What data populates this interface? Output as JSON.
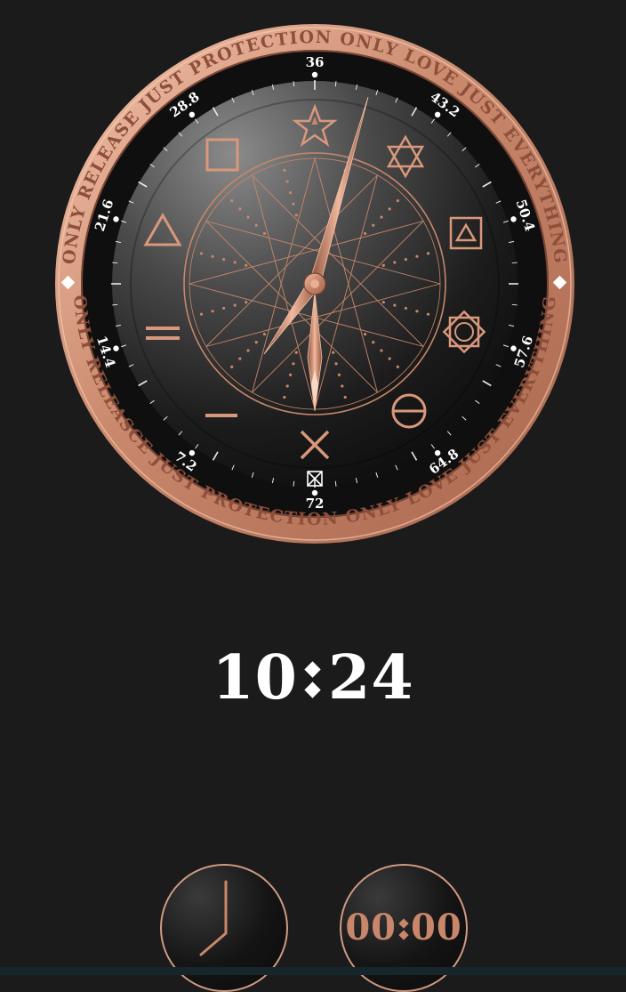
{
  "theme": {
    "background": "#1b1b1b",
    "accent_copper": "#c8876a",
    "accent_copper_light": "#f2c1a8",
    "text_white": "#ffffff"
  },
  "dial": {
    "ring_text": "ONLY RELEASE JUST PROTECTION ONLY LOVE JUST EVERYTHING",
    "ring_text_lower": "ONLY RELEASCE JUST PROTECTION ONLY LOVE JUST EVERYTHING",
    "scale_labels": [
      "36",
      "43.2",
      "50.4",
      "57.6",
      "64.8",
      "72",
      "7.2",
      "14.4",
      "21.6",
      "28.8"
    ],
    "symbols": [
      "pentagram-icon",
      "hexagram-icon",
      "square-triangle-icon",
      "octagram-icon",
      "theta-circle-icon",
      "cross-icon",
      "boxed-x-icon",
      "dash-icon",
      "double-line-icon",
      "triangle-icon",
      "square-icon"
    ],
    "hour_hand_time": "7:30",
    "minute_hand_time": "0:40"
  },
  "digital_time": {
    "hours": "10",
    "minutes": "24"
  },
  "buttons": {
    "stopwatch_minutes": "00",
    "stopwatch_seconds": "00"
  }
}
